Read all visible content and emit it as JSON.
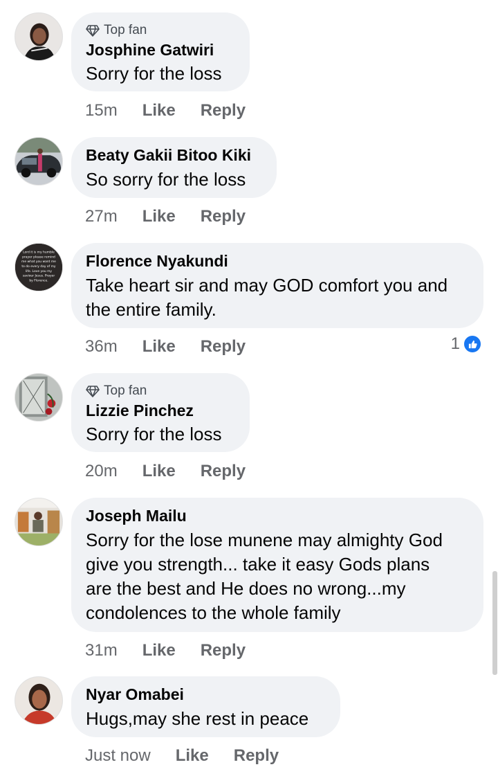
{
  "labels": {
    "like": "Like",
    "reply": "Reply",
    "top_fan": "Top fan"
  },
  "comments": [
    {
      "name": "Josphine Gatwiri",
      "badge": "Top fan",
      "text": [
        "Sorry for the loss"
      ],
      "time": "15m"
    },
    {
      "name": "Beaty Gakii Bitoo Kiki",
      "text": [
        "So sorry for the loss"
      ],
      "time": "27m"
    },
    {
      "name": "Florence Nyakundi",
      "text": [
        "Take heart sir and may GOD comfort you and",
        "the entire family."
      ],
      "time": "36m",
      "reaction_count": "1"
    },
    {
      "name": "Lizzie Pinchez",
      "badge": "Top fan",
      "text": [
        "Sorry for the loss"
      ],
      "time": "20m"
    },
    {
      "name": "Joseph Mailu",
      "text": [
        "Sorry for the lose munene may almighty God",
        "give you strength... take it easy Gods plans",
        "are the best and He does no wrong...my",
        "condolences to the whole family"
      ],
      "time": "31m"
    },
    {
      "name": "Nyar Omabei",
      "text": [
        "Hugs,may she rest in peace"
      ],
      "time": "Just now"
    }
  ],
  "avatars": {
    "florence_caption": [
      "Lord it is my humble",
      "prayer please remind",
      "me what you want me",
      "to do every day of my",
      "life. Love you my",
      "saviour Jesus. Prayer",
      "by Florence."
    ]
  },
  "colors": {
    "bubble": "#f0f2f5",
    "meta": "#65676b",
    "accent": "#1877f2"
  }
}
